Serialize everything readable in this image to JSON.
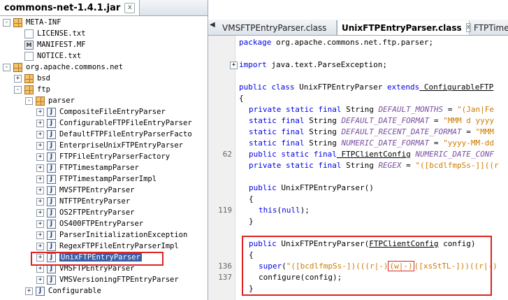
{
  "left_tab": {
    "label": "commons-net-1.4.1.jar",
    "close": "x"
  },
  "tree": [
    {
      "label": "META-INF",
      "icon": "package",
      "expander": "-"
    },
    {
      "label": "LICENSE.txt",
      "icon": "file"
    },
    {
      "label": "MANIFEST.MF",
      "icon": "manifest",
      "icon_text": "M"
    },
    {
      "label": "NOTICE.txt",
      "icon": "file"
    },
    {
      "label": "org.apache.commons.net",
      "icon": "package",
      "expander": "-"
    },
    {
      "label": "bsd",
      "icon": "package",
      "expander": "+"
    },
    {
      "label": "ftp",
      "icon": "package",
      "expander": "-"
    },
    {
      "label": "parser",
      "icon": "package",
      "expander": "-"
    },
    {
      "label": "CompositeFileEntryParser",
      "icon": "class",
      "icon_text": "J",
      "expander": "+"
    },
    {
      "label": "ConfigurableFTPFileEntryParser",
      "icon": "class",
      "icon_text": "J",
      "expander": "+"
    },
    {
      "label": "DefaultFTPFileEntryParserFacto",
      "icon": "class",
      "icon_text": "J",
      "expander": "+"
    },
    {
      "label": "EnterpriseUnixFTPEntryParser",
      "icon": "class",
      "icon_text": "J",
      "expander": "+"
    },
    {
      "label": "FTPFileEntryParserFactory",
      "icon": "class",
      "icon_text": "J",
      "expander": "+"
    },
    {
      "label": "FTPTimestampParser",
      "icon": "class",
      "icon_text": "J",
      "expander": "+"
    },
    {
      "label": "FTPTimestampParserImpl",
      "icon": "class",
      "icon_text": "J",
      "expander": "+"
    },
    {
      "label": "MVSFTPEntryParser",
      "icon": "class",
      "icon_text": "J",
      "expander": "+"
    },
    {
      "label": "NTFTPEntryParser",
      "icon": "class",
      "icon_text": "J",
      "expander": "+"
    },
    {
      "label": "OS2FTPEntryParser",
      "icon": "class",
      "icon_text": "J",
      "expander": "+"
    },
    {
      "label": "OS400FTPEntryParser",
      "icon": "class",
      "icon_text": "J",
      "expander": "+"
    },
    {
      "label": "ParserInitializationException",
      "icon": "class",
      "icon_text": "J",
      "expander": "+"
    },
    {
      "label": "RegexFTPFileEntryParserImpl",
      "icon": "class",
      "icon_text": "J",
      "expander": "+"
    },
    {
      "label": "UnixFTPEntryParser",
      "icon": "class",
      "icon_text": "J",
      "expander": "+",
      "selected": true
    },
    {
      "label": "VMSFTPEntryParser",
      "icon": "class",
      "icon_text": "J",
      "expander": "+"
    },
    {
      "label": "VMSVersioningFTPEntryParser",
      "icon": "class",
      "icon_text": "J",
      "expander": "+"
    },
    {
      "label": "Configurable",
      "icon": "class",
      "icon_text": "J",
      "expander": "+"
    }
  ],
  "editor_tabs": [
    {
      "label": "VMSFTPEntryParser.class",
      "close": "x"
    },
    {
      "label": "UnixFTPEntryParser.class",
      "close": "x"
    },
    {
      "label": "FTPTimes"
    }
  ],
  "tab_nav_left": "◀",
  "fold_marker": "+",
  "gutter_numbers": [
    {
      "n": "62"
    },
    {
      "n": "119"
    },
    {
      "n": "136"
    },
    {
      "n": "137"
    }
  ],
  "code": {
    "line1": [
      "package",
      " org.apache.commons.net.ftp.parser;"
    ],
    "line2": [
      "import",
      " java.text.ParseException;"
    ],
    "line3": [
      "public class",
      " UnixFTPEntryParser ",
      "extends",
      " ConfigurableFTP"
    ],
    "line4": [
      "{"
    ],
    "line5": [
      "private static final",
      " String ",
      "DEFAULT_MONTHS",
      " = ",
      "\"(Jan|Fe"
    ],
    "line6": [
      "static final",
      " String ",
      "DEFAULT_DATE_FORMAT",
      " = ",
      "\"MMM d yyyy"
    ],
    "line7": [
      "static final",
      " String ",
      "DEFAULT_RECENT_DATE_FORMAT",
      " = ",
      "\"MMM"
    ],
    "line8": [
      "static final",
      " String ",
      "NUMERIC_DATE_FORMAT",
      " = ",
      "\"yyyy-MM-dd"
    ],
    "line9": [
      "public static final",
      " FTPClientConfig",
      " NUMERIC_DATE_CONF"
    ],
    "line10": [
      "private static final",
      " String ",
      "REGEX",
      " = ",
      "\"([bcdlfmpSs-]]((r"
    ],
    "line11": [
      "public",
      " UnixFTPEntryParser()"
    ],
    "line12": [
      "{"
    ],
    "line13": [
      "this",
      "(",
      "null",
      ");"
    ],
    "line14": [
      "}"
    ],
    "line15": [
      "public",
      " UnixFTPEntryParser(",
      "FTPClientConfig",
      " config)"
    ],
    "line16": [
      "{"
    ],
    "line17": [
      "super",
      "(",
      "\"([bcdlfmpSs-])(((r|-)",
      "(w|-)",
      "([xsStTL-]))((r|-)"
    ],
    "line18": [
      "configure(config);"
    ],
    "line19": [
      "}"
    ]
  }
}
